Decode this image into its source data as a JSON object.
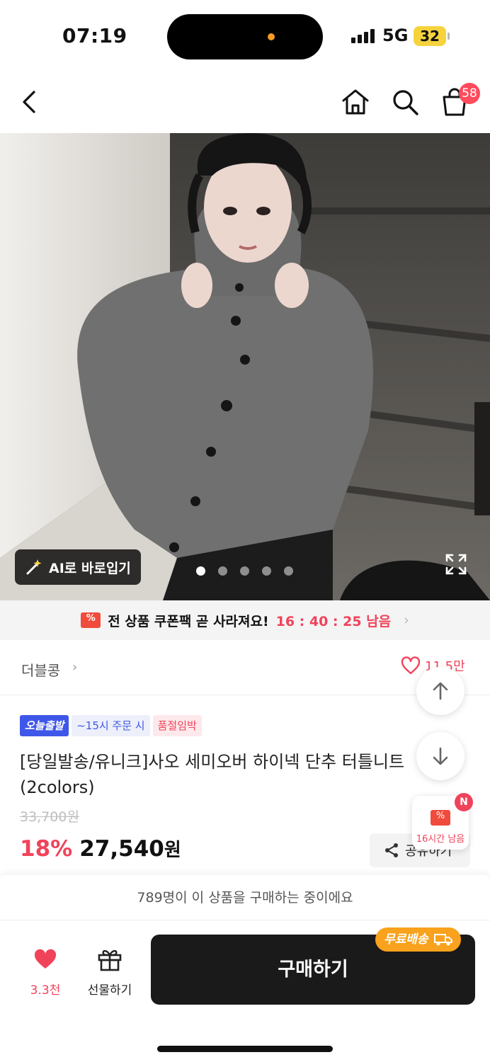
{
  "status_bar": {
    "time": "07:19",
    "network": "5G",
    "battery": "32"
  },
  "header": {
    "cart_count": "58",
    "icons": [
      "back-icon",
      "home-icon",
      "search-icon",
      "cart-icon"
    ]
  },
  "gallery": {
    "ai_button_label": "AI로 바로입기",
    "total_images": 5,
    "active_index": 0
  },
  "coupon_banner": {
    "text": "전 상품 쿠폰팩 곧 사라져요!",
    "countdown": "16 : 40 : 25 남음"
  },
  "brand": {
    "name": "더블콩",
    "like_count": "11.5만"
  },
  "product": {
    "tags": [
      "오늘출발",
      "~15시 주문 시",
      "품절임박"
    ],
    "title": "[당일발송/유니크]사오 세미오버 하이넥 단추 터틀니트 (2colors)",
    "original_price": "33,700원",
    "discount": "18%",
    "price": "27,540",
    "price_unit": "원",
    "share_label": "공유하기"
  },
  "coupon_widget": {
    "text": "16시간 남음",
    "badge": "N"
  },
  "bottom": {
    "buyers_text": "789명이 이 상품을 구매하는 중이에요",
    "wish_count": "3.3천",
    "gift_label": "선물하기",
    "buy_label": "구매하기",
    "free_shipping_label": "무료배송"
  },
  "colors": {
    "accent": "#f0435a",
    "brand_blue": "#3f57e8",
    "shipping": "#f8a21d",
    "buy_button": "#1a1a1a"
  }
}
